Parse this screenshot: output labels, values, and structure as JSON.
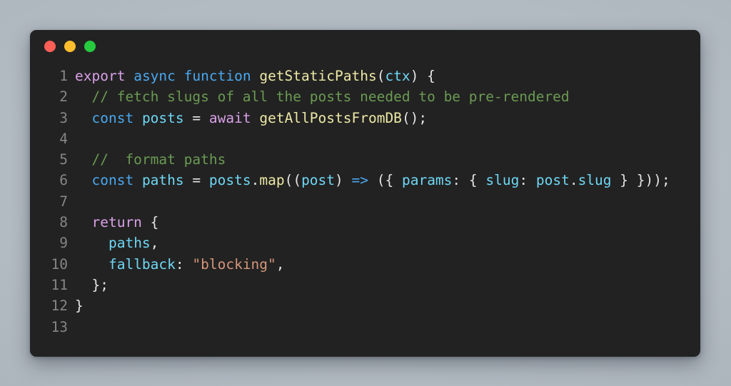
{
  "window": {
    "background_color": "#222222",
    "page_background_color": "#b2bac2",
    "traffic_lights": [
      {
        "name": "close",
        "label": "Close",
        "color": "#ff5f56"
      },
      {
        "name": "minimize",
        "label": "Minimize",
        "color": "#ffbd2e"
      },
      {
        "name": "zoom",
        "label": "Zoom",
        "color": "#27c93f"
      }
    ]
  },
  "editor": {
    "language": "javascript",
    "gutter_color": "#868686",
    "token_colors": {
      "keyword": "#d9a0e8",
      "control": "#4aa8f0",
      "function": "#ece8a6",
      "variable": "#6fd7f5",
      "punctuation": "#e4e4e4",
      "comment": "#6a9a52",
      "string": "#d6967a"
    },
    "line_numbers": [
      "1",
      "2",
      "3",
      "4",
      "5",
      "6",
      "7",
      "8",
      "9",
      "10",
      "11",
      "12",
      "13"
    ],
    "plain_code": "export async function getStaticPaths(ctx) {\n  // fetch slugs of all the posts needed to be pre-rendered\n  const posts = await getAllPostsFromDB();\n\n  //  format paths\n  const paths = posts.map((post) => ({ params: { slug: post.slug } }));\n\n  return {\n    paths,\n    fallback: \"blocking\",\n  };\n}\n",
    "lines": [
      {
        "number": "1",
        "tokens": [
          {
            "t": "export",
            "c": "keyword"
          },
          {
            "t": " ",
            "c": "punct"
          },
          {
            "t": "async",
            "c": "control"
          },
          {
            "t": " ",
            "c": "punct"
          },
          {
            "t": "function",
            "c": "control"
          },
          {
            "t": " ",
            "c": "punct"
          },
          {
            "t": "getStaticPaths",
            "c": "function"
          },
          {
            "t": "(",
            "c": "punct"
          },
          {
            "t": "ctx",
            "c": "variable"
          },
          {
            "t": ") {",
            "c": "punct"
          }
        ]
      },
      {
        "number": "2",
        "tokens": [
          {
            "t": "  ",
            "c": "punct"
          },
          {
            "t": "// fetch slugs of all the posts needed to be pre-rendered",
            "c": "comment"
          }
        ]
      },
      {
        "number": "3",
        "tokens": [
          {
            "t": "  ",
            "c": "punct"
          },
          {
            "t": "const",
            "c": "control"
          },
          {
            "t": " ",
            "c": "punct"
          },
          {
            "t": "posts",
            "c": "variable"
          },
          {
            "t": " ",
            "c": "punct"
          },
          {
            "t": "=",
            "c": "operator"
          },
          {
            "t": " ",
            "c": "punct"
          },
          {
            "t": "await",
            "c": "keyword"
          },
          {
            "t": " ",
            "c": "punct"
          },
          {
            "t": "getAllPostsFromDB",
            "c": "function"
          },
          {
            "t": "();",
            "c": "punct"
          }
        ]
      },
      {
        "number": "4",
        "tokens": []
      },
      {
        "number": "5",
        "tokens": [
          {
            "t": "  ",
            "c": "punct"
          },
          {
            "t": "//  format paths",
            "c": "comment"
          }
        ]
      },
      {
        "number": "6",
        "tokens": [
          {
            "t": "  ",
            "c": "punct"
          },
          {
            "t": "const",
            "c": "control"
          },
          {
            "t": " ",
            "c": "punct"
          },
          {
            "t": "paths",
            "c": "variable"
          },
          {
            "t": " ",
            "c": "punct"
          },
          {
            "t": "=",
            "c": "operator"
          },
          {
            "t": " ",
            "c": "punct"
          },
          {
            "t": "posts",
            "c": "variable"
          },
          {
            "t": ".",
            "c": "punct"
          },
          {
            "t": "map",
            "c": "function"
          },
          {
            "t": "((",
            "c": "punct"
          },
          {
            "t": "post",
            "c": "variable"
          },
          {
            "t": ") ",
            "c": "punct"
          },
          {
            "t": "=>",
            "c": "control"
          },
          {
            "t": " ({ ",
            "c": "punct"
          },
          {
            "t": "params",
            "c": "variable"
          },
          {
            "t": ": { ",
            "c": "punct"
          },
          {
            "t": "slug",
            "c": "variable"
          },
          {
            "t": ": ",
            "c": "punct"
          },
          {
            "t": "post",
            "c": "variable"
          },
          {
            "t": ".",
            "c": "punct"
          },
          {
            "t": "slug",
            "c": "variable"
          },
          {
            "t": " } }));",
            "c": "punct"
          }
        ]
      },
      {
        "number": "7",
        "tokens": []
      },
      {
        "number": "8",
        "tokens": [
          {
            "t": "  ",
            "c": "punct"
          },
          {
            "t": "return",
            "c": "keyword"
          },
          {
            "t": " {",
            "c": "punct"
          }
        ]
      },
      {
        "number": "9",
        "tokens": [
          {
            "t": "    ",
            "c": "punct"
          },
          {
            "t": "paths",
            "c": "variable"
          },
          {
            "t": ",",
            "c": "punct"
          }
        ]
      },
      {
        "number": "10",
        "tokens": [
          {
            "t": "    ",
            "c": "punct"
          },
          {
            "t": "fallback",
            "c": "variable"
          },
          {
            "t": ": ",
            "c": "punct"
          },
          {
            "t": "\"blocking\"",
            "c": "string"
          },
          {
            "t": ",",
            "c": "punct"
          }
        ]
      },
      {
        "number": "11",
        "tokens": [
          {
            "t": "  };",
            "c": "punct"
          }
        ]
      },
      {
        "number": "12",
        "tokens": [
          {
            "t": "}",
            "c": "punct"
          }
        ]
      },
      {
        "number": "13",
        "tokens": []
      }
    ]
  }
}
